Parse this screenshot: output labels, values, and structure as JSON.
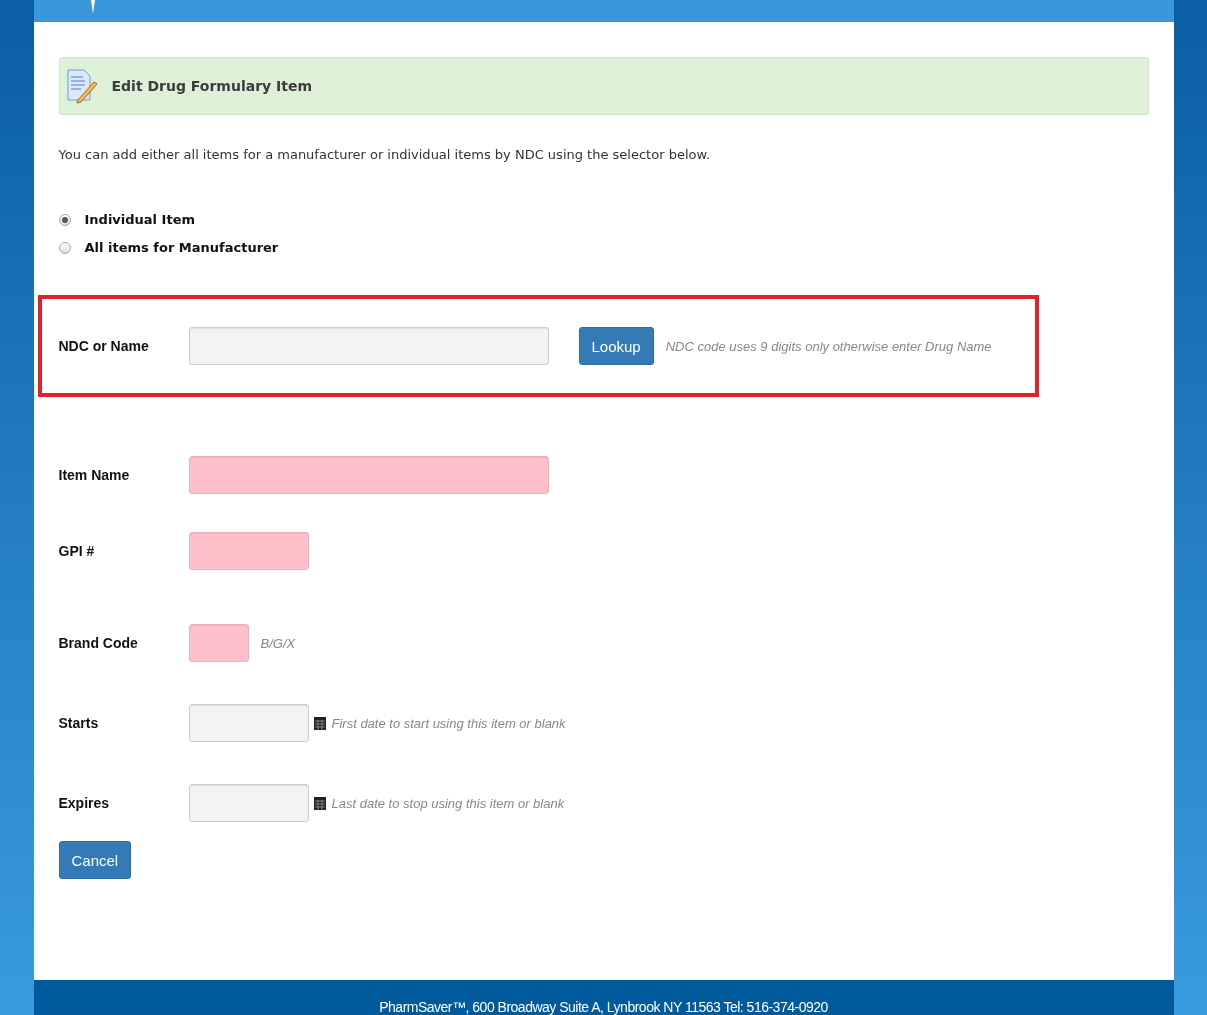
{
  "banner": {
    "title": "Edit Drug Formulary Item"
  },
  "intro": "You can add either all items for a manufacturer or individual items by NDC using the selector below.",
  "mode_options": [
    {
      "label": "Individual Item",
      "selected": true
    },
    {
      "label": "All items for Manufacturer",
      "selected": false
    }
  ],
  "fields": [
    {
      "kind": "lookup",
      "label": "NDC or Name",
      "highlighted": true,
      "invalid": false,
      "button": "Lookup",
      "hint": "NDC code uses 9 digits only otherwise enter Drug Name"
    },
    {
      "kind": "text",
      "label": "Item Name",
      "highlighted": false,
      "invalid": true
    },
    {
      "kind": "code",
      "label": "GPI #",
      "highlighted": false,
      "invalid": true
    },
    {
      "kind": "short",
      "label": "Brand Code",
      "highlighted": false,
      "invalid": true,
      "hint": "B/G/X"
    },
    {
      "kind": "date",
      "label": "Starts",
      "highlighted": false,
      "invalid": false,
      "hint": "First date to start using this item or blank"
    },
    {
      "kind": "date",
      "label": "Expires",
      "highlighted": false,
      "invalid": false,
      "hint": "Last date to stop using this item or blank"
    }
  ],
  "cancel_button": "Cancel",
  "footer": "PharmSaver™, 600 Broadway Suite A, Lynbrook NY 11563 Tel: 516-374-0920"
}
